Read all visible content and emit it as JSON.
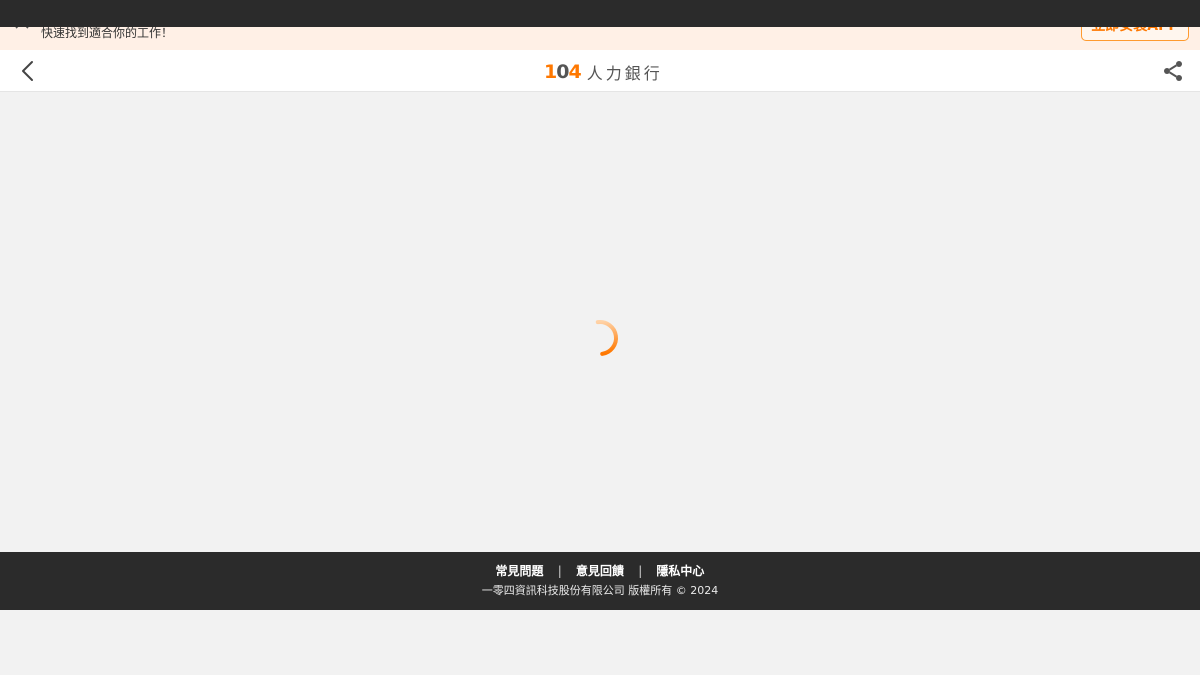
{
  "promo_banner": {
    "message": "快速找到適合你的工作！",
    "install_label": "立即安裝APP",
    "close_icon": "close-icon"
  },
  "header": {
    "logo_number_1": "1",
    "logo_number_0": "0",
    "logo_number_4": "4",
    "logo_name": "人力銀行",
    "back_icon": "chevron-left-icon",
    "share_icon": "share-icon"
  },
  "main": {
    "state": "loading",
    "spinner_icon": "loading-spinner-icon"
  },
  "footer": {
    "links": [
      "常見問題",
      "意見回饋",
      "隱私中心"
    ],
    "separator": "|",
    "copyright": "一零四資訊科技股份有限公司 版權所有 © 2024"
  },
  "colors": {
    "brand_orange": "#ff7800",
    "dark_bar": "#2b2b2b",
    "promo_bg": "#fff0e6",
    "page_bg": "#f2f2f2"
  }
}
